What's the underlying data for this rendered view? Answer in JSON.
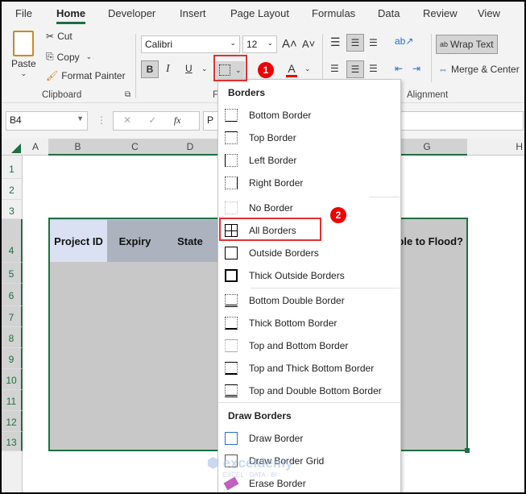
{
  "tabs": [
    "File",
    "Home",
    "Developer",
    "Insert",
    "Page Layout",
    "Formulas",
    "Data",
    "Review",
    "View"
  ],
  "clipboard": {
    "paste": "Paste",
    "cut": "Cut",
    "copy": "Copy",
    "format_painter": "Format Painter",
    "group": "Clipboard"
  },
  "font": {
    "name": "Calibri",
    "size": "12",
    "group_partial": "F",
    "bold": "B",
    "italic": "I",
    "underline": "U",
    "font_color": "A"
  },
  "alignment": {
    "wrap_text": "Wrap Text",
    "merge_center": "Merge & Center",
    "group": "Alignment"
  },
  "formula_bar": {
    "name_box": "B4",
    "fx": "fx",
    "content_partial": "P"
  },
  "columns": [
    "A",
    "B",
    "C",
    "D",
    "G",
    "H"
  ],
  "rows": [
    "1",
    "2",
    "3",
    "4",
    "5",
    "6",
    "7",
    "8",
    "9",
    "10",
    "11",
    "12",
    "13"
  ],
  "table_headers": {
    "b": "Project ID",
    "c": "Expiry",
    "d": "State",
    "g": "Vulnerable to Flood?"
  },
  "menu": {
    "header": "Borders",
    "items": [
      "Bottom Border",
      "Top Border",
      "Left Border",
      "Right Border",
      "No Border",
      "All Borders",
      "Outside Borders",
      "Thick Outside Borders",
      "Bottom Double Border",
      "Thick Bottom Border",
      "Top and Bottom Border",
      "Top and Thick Bottom Border",
      "Top and Double Bottom Border"
    ],
    "draw_header": "Draw Borders",
    "draw_items": [
      "Draw Border",
      "Draw Border Grid",
      "Erase Border"
    ]
  },
  "steps": [
    "1",
    "2"
  ],
  "watermark": "exceldemy EXCEL · DATA · BI",
  "colors": {
    "accent": "#1e6e43",
    "highlight": "#e03030",
    "header_fill": "#acb3bf",
    "selected_fill": "#d9e1f2",
    "body_fill": "#c8c8c8"
  }
}
